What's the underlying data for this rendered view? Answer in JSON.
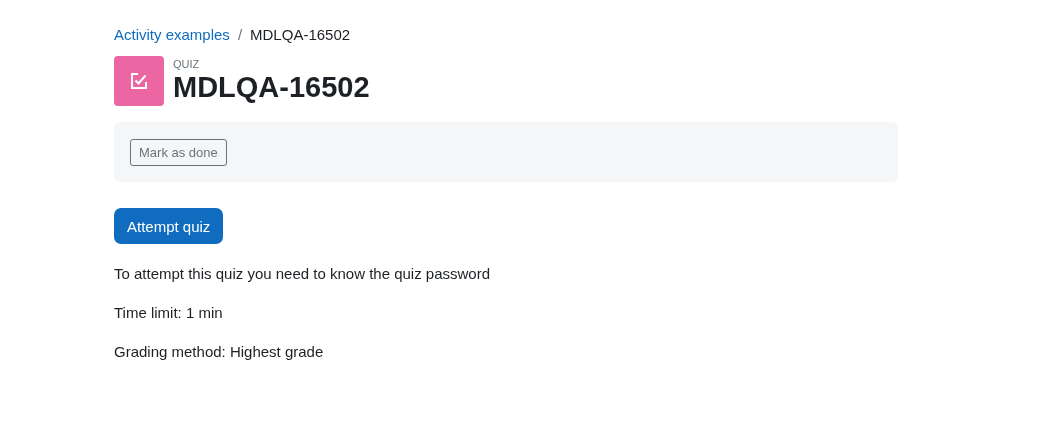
{
  "breadcrumb": [
    {
      "label": "Activity examples",
      "kind": "link"
    },
    {
      "label": "MDLQA-16502",
      "kind": "current"
    }
  ],
  "separator": "/",
  "header": {
    "type_label": "QUIZ",
    "title": "MDLQA-16502"
  },
  "completion": {
    "button": "Mark as done"
  },
  "primary_button": "Attempt quiz",
  "info": [
    "To attempt this quiz you need to know the quiz password",
    "Time limit: 1 min",
    "Grading method: Highest grade"
  ]
}
